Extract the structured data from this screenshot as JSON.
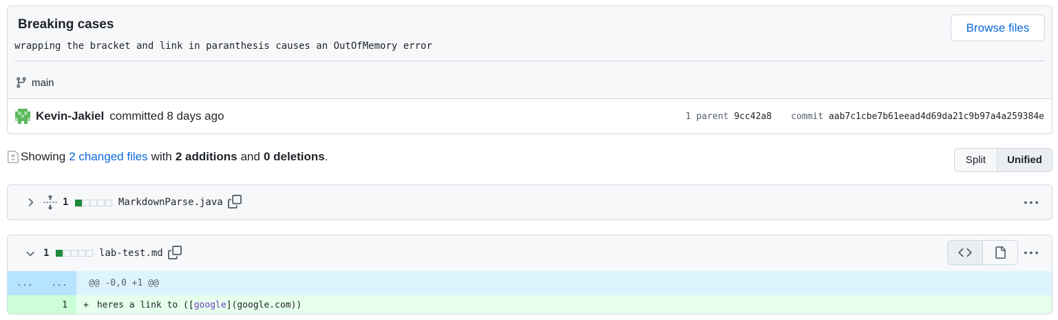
{
  "commit": {
    "title": "Breaking cases",
    "description": "wrapping the bracket and link in paranthesis causes an OutOfMemory error",
    "browse_label": "Browse files",
    "branch": "main",
    "author": "Kevin-Jakiel",
    "committed_text": "committed 8 days ago",
    "parent_label": "1 parent",
    "parent_sha": "9cc42a8",
    "commit_label": "commit",
    "commit_sha": "aab7c1cbe7b61eead4d69da21c9b97a4a259384e"
  },
  "toc": {
    "showing": "Showing",
    "changed_files": "2 changed files",
    "with": "with",
    "additions": "2 additions",
    "and": "and",
    "deletions": "0 deletions",
    "period": "."
  },
  "view_toggle": {
    "split": "Split",
    "unified": "Unified",
    "selected": "Unified"
  },
  "files": [
    {
      "name": "MarkdownParse.java",
      "changes": "1",
      "collapsed": true
    },
    {
      "name": "lab-test.md",
      "changes": "1",
      "collapsed": false
    }
  ],
  "diff": {
    "hunk_left": "...",
    "hunk_right": "...",
    "hunk_header": "@@ -0,0 +1 @@",
    "lines": [
      {
        "old": "",
        "new": "1",
        "sign": "+",
        "pre": "heres a link to ([",
        "link": "google",
        "post": "](google.com))"
      }
    ]
  },
  "colors": {
    "accent": "#0969da",
    "addition": "#1f883d",
    "hunk_bg": "#ddf4ff",
    "add_bg": "#e6ffec"
  },
  "icons": [
    "git-branch-icon",
    "avatar-identicon",
    "diff-file-icon",
    "chevron-right-icon",
    "chevron-down-icon",
    "unfold-icon",
    "copy-icon",
    "kebab-horizontal-icon",
    "code-icon",
    "file-icon"
  ]
}
